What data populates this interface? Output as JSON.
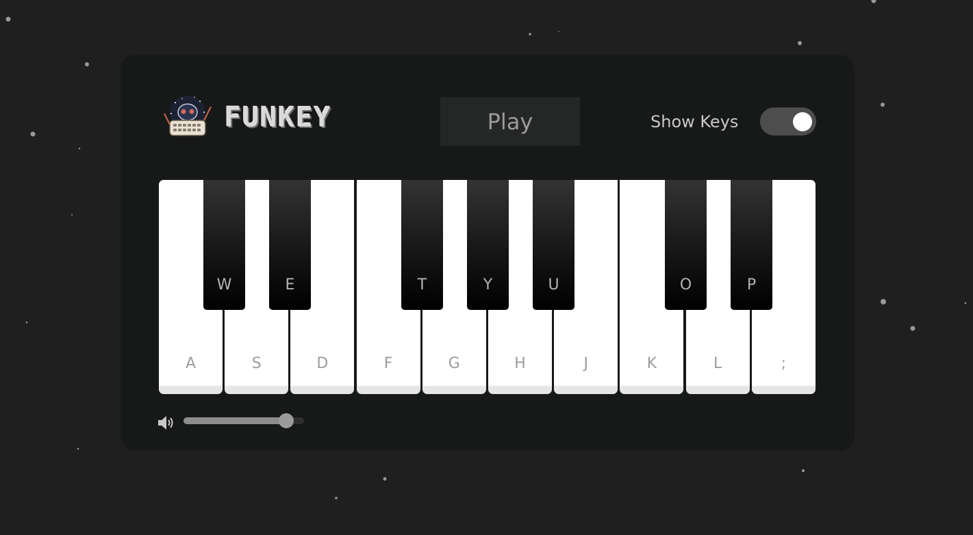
{
  "app": {
    "brand_name": "FUNKEY",
    "logo_icon": "robot-typewriter-logo"
  },
  "header": {
    "play_label": "Play",
    "show_keys_label": "Show Keys",
    "show_keys_enabled": true
  },
  "keyboard": {
    "white_keys": [
      {
        "label": "A"
      },
      {
        "label": "S"
      },
      {
        "label": "D"
      },
      {
        "label": "F"
      },
      {
        "label": "G"
      },
      {
        "label": "H"
      },
      {
        "label": "J"
      },
      {
        "label": "K"
      },
      {
        "label": "L"
      },
      {
        "label": ";"
      }
    ],
    "black_keys": [
      {
        "label": "W"
      },
      {
        "label": "E"
      },
      {
        "label": "T"
      },
      {
        "label": "Y"
      },
      {
        "label": "U"
      },
      {
        "label": "O"
      },
      {
        "label": "P"
      }
    ]
  },
  "volume": {
    "icon": "speaker-volume-icon",
    "level": 0.9
  },
  "colors": {
    "background": "#1f1f1f",
    "panel": "#171818",
    "play_button_bg": "#252626",
    "toggle_track": "#4d4d4d",
    "white_key": "#ffffff",
    "black_key": "#000000"
  }
}
